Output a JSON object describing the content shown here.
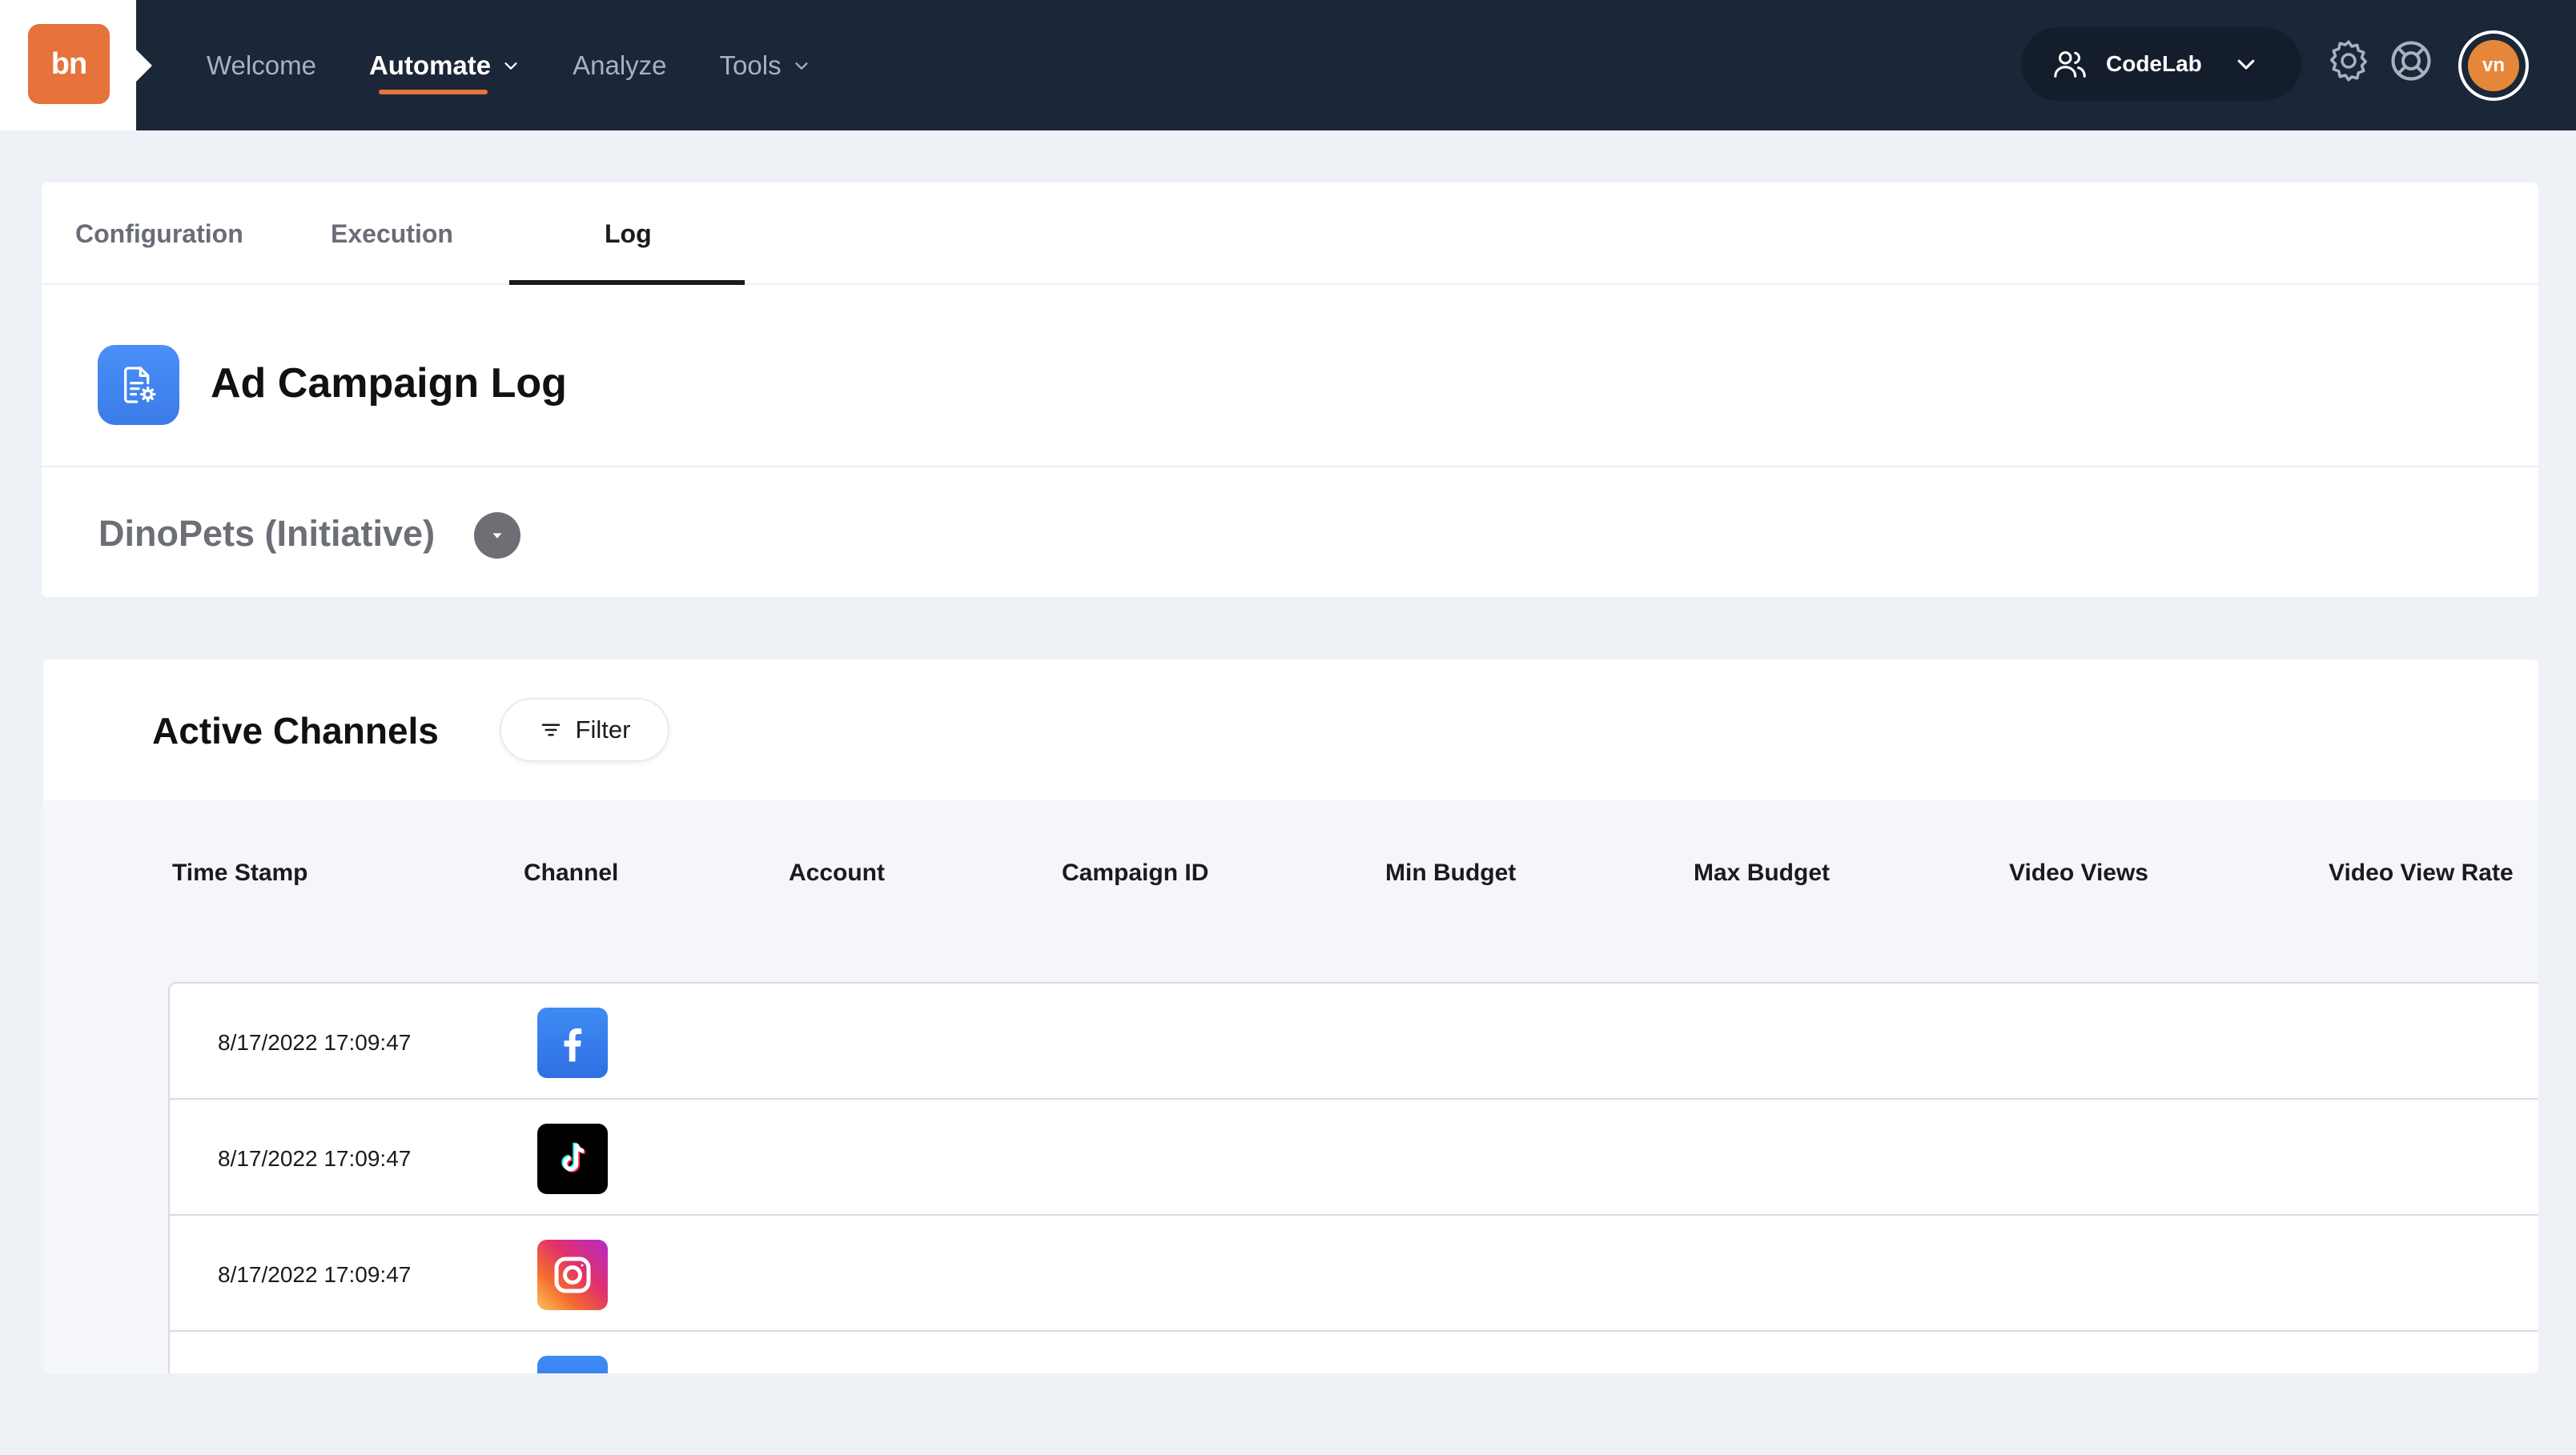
{
  "brand": {
    "logo_text": "bn",
    "accent": "#e5733b",
    "nav_bg": "#1b2638"
  },
  "nav": {
    "items": [
      {
        "label": "Welcome",
        "active": false,
        "has_dropdown": false
      },
      {
        "label": "Automate",
        "active": true,
        "has_dropdown": true
      },
      {
        "label": "Analyze",
        "active": false,
        "has_dropdown": false
      },
      {
        "label": "Tools",
        "active": false,
        "has_dropdown": true
      }
    ]
  },
  "account": {
    "workspace": "CodeLab",
    "avatar_initials": "vn"
  },
  "icons": {
    "settings": "gear-icon",
    "help": "lifebuoy-icon",
    "workspace": "users-icon"
  },
  "tabs": [
    {
      "label": "Configuration",
      "active": false
    },
    {
      "label": "Execution",
      "active": false
    },
    {
      "label": "Log",
      "active": true
    }
  ],
  "page": {
    "title": "Ad Campaign Log",
    "initiative": "DinoPets (Initiative)"
  },
  "channels": {
    "title": "Active Channels",
    "filter_label": "Filter",
    "columns": [
      "Time Stamp",
      "Channel",
      "Account",
      "Campaign ID",
      "Min Budget",
      "Max Budget",
      "Video Views",
      "Video View Rate"
    ],
    "rows": [
      {
        "timestamp": "8/17/2022 17:09:47",
        "channel": "facebook"
      },
      {
        "timestamp": "8/17/2022 17:09:47",
        "channel": "tiktok"
      },
      {
        "timestamp": "8/17/2022 17:09:47",
        "channel": "instagram"
      },
      {
        "timestamp": "",
        "channel": "facebook"
      }
    ]
  }
}
